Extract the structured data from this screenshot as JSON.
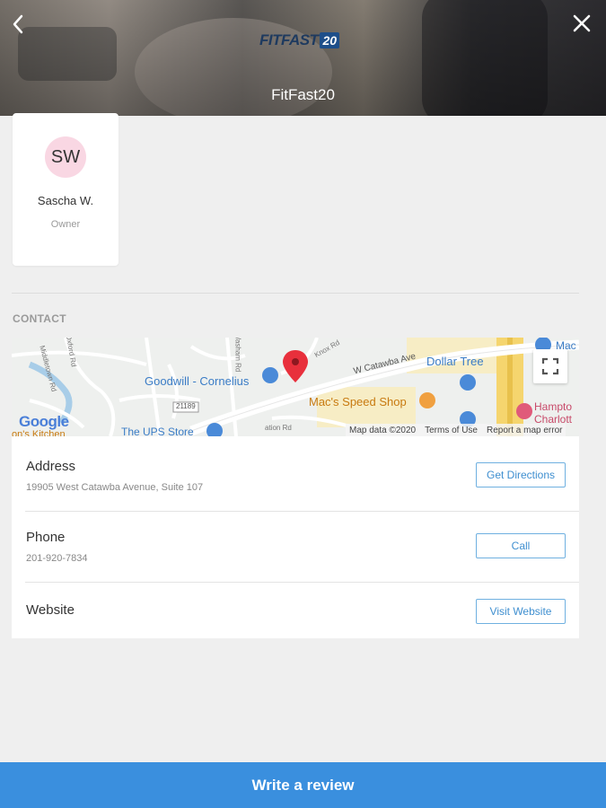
{
  "header": {
    "title": "FitFast20",
    "logo_text": "FITFAST",
    "logo_badge": "20",
    "back_icon": "chevron-left-icon",
    "close_icon": "close-icon"
  },
  "staff": {
    "initials": "SW",
    "name": "Sascha W.",
    "role": "Owner",
    "avatar_color": "#f9d7e3"
  },
  "contact": {
    "section_label": "CONTACT",
    "map": {
      "labels": {
        "goodwill": "Goodwill - Cornelius",
        "dollar_tree": "Dollar Tree",
        "macs": "Mac's Speed Shop",
        "hampton_1": "Hampto",
        "hampton_2": "Charlott",
        "mac_top": "Mac",
        "ups": "The UPS Store",
        "kitchen": "on's Kitchen",
        "road_catawba": "W Catawba Ave",
        "road_21189": "21189",
        "road_knox": "Knox Rd",
        "road_middletown": "Middletown Rd",
        "road_oxford": "Oxford Rd",
        "road_sta": "ation Rd",
        "road_ws": "Washam Rd"
      },
      "google": "Google",
      "attribution": {
        "map_data": "Map data ©2020",
        "terms": "Terms of Use",
        "report": "Report a map error"
      },
      "pin_color": "#e8303c"
    },
    "rows": [
      {
        "title": "Address",
        "detail": "19905 West Catawba Avenue, Suite 107",
        "button": "Get Directions"
      },
      {
        "title": "Phone",
        "detail": "201-920-7834",
        "button": "Call"
      },
      {
        "title": "Website",
        "detail": "",
        "button": "Visit Website"
      }
    ]
  },
  "footer": {
    "review_button": "Write a review",
    "color": "#3a8fde"
  }
}
